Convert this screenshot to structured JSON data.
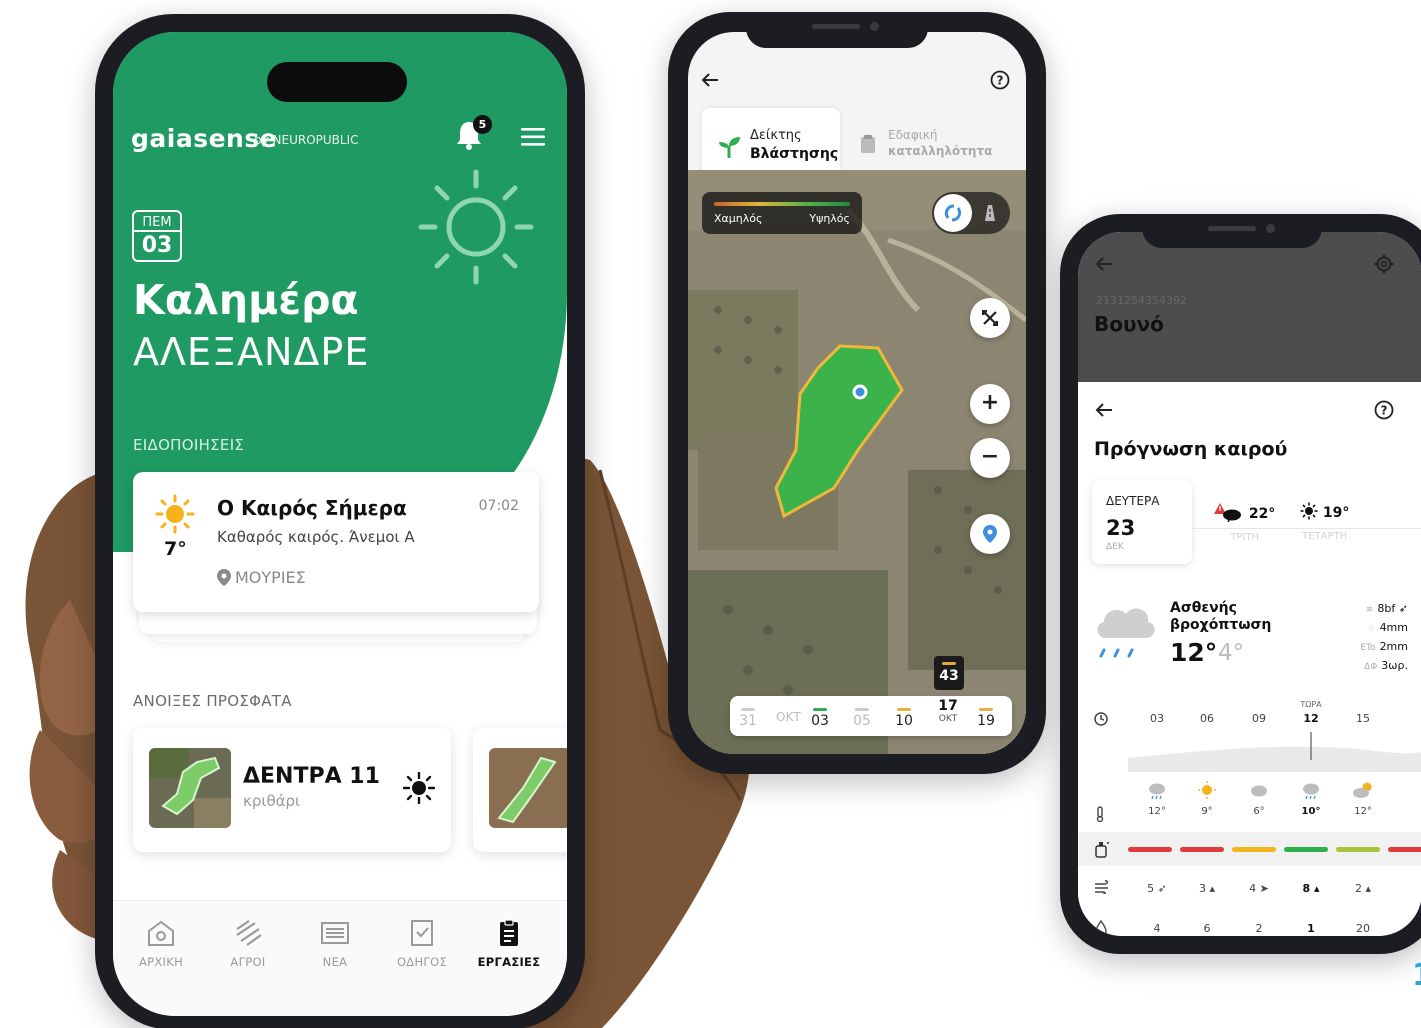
{
  "home": {
    "brand": "gaiasense",
    "brand_by": "by NEUROPUBLIC",
    "notification_count": "5",
    "date_day": "ΠΕΜ",
    "date_num": "03",
    "greeting": "Καλημέρα",
    "user_name": "ΑΛΕΞΑΝΔΡΕ",
    "notifications_label": "ΕΙΔΟΠΟΙΗΣΕΙΣ",
    "notification": {
      "title": "Ο Καιρός Σήμερα",
      "time": "07:02",
      "body": "Καθαρός καιρός. Άνεμοι Α",
      "temp": "7°",
      "location": "ΜΟΥΡΙΕΣ"
    },
    "recent_label": "ΑΝΟΙΞΕΣ ΠΡΟΣΦΑΤΑ",
    "recent": [
      {
        "title": "ΔΕΝΤΡΑ 11",
        "subtitle": "κριθάρι",
        "weather_icon": "sun-icon"
      }
    ],
    "nav": [
      {
        "label": "ΑΡΧΙΚΗ",
        "icon": "home-icon",
        "active": false
      },
      {
        "label": "ΑΓΡΟΙ",
        "icon": "fields-icon",
        "active": false
      },
      {
        "label": "ΝΕΑ",
        "icon": "news-icon",
        "active": false
      },
      {
        "label": "ΟΔΗΓΟΣ",
        "icon": "guide-icon",
        "active": false
      },
      {
        "label": "ΕΡΓΑΣΙΕΣ",
        "icon": "tasks-icon",
        "active": true
      }
    ],
    "accent": "#1f9a62"
  },
  "map": {
    "tab_active": {
      "line1": "Δείκτης",
      "line2": "Βλάστησης"
    },
    "tab_inactive": {
      "line1": "Εδαφική",
      "line2": "καταλληλότητα"
    },
    "legend_low": "Χαμηλός",
    "legend_high": "Υψηλός",
    "timeline": {
      "items": [
        "31",
        "ΟΚΤ",
        "03",
        "05",
        "10",
        "17",
        "19"
      ],
      "selected_day": "17",
      "selected_month": "ΟΚΤ",
      "popup_value": "43"
    }
  },
  "forecast": {
    "field_id": "2131254354392",
    "field_name": "Βουνό",
    "title": "Πρόγνωση καιρού",
    "today": {
      "name": "ΔΕΥΤΕΡΑ",
      "day": "23",
      "month": "ΔΕΚ"
    },
    "next_days": [
      {
        "name": "ΤΡΙΤΗ",
        "temp": "22°",
        "icon": "storm-warning-icon"
      },
      {
        "name": "ΤΕΤΑΡΤΗ",
        "temp": "19°",
        "icon": "sun-icon"
      }
    ],
    "current": {
      "description_line1": "Ασθενής",
      "description_line2": "βροχόπτωση",
      "max": "12°",
      "min": "4°",
      "wind": "8bf",
      "rain": "4mm",
      "eto_label": "ETo",
      "eto": "2mm",
      "dp_label": "ΔΦ",
      "dp": "3ωρ."
    },
    "now_label": "ΤΩΡΑ",
    "hours": [
      "03",
      "06",
      "09",
      "12",
      "15"
    ],
    "temps": [
      "12°",
      "9°",
      "6°",
      "10°",
      "12°"
    ],
    "winds": [
      "5",
      "3",
      "4",
      "8",
      "2"
    ],
    "rains": [
      "4",
      "6",
      "2",
      "1",
      "20"
    ],
    "spray_colors": [
      "#e03a3a",
      "#e03a3a",
      "#f2b51e",
      "#2fae4e",
      "#a8c23a",
      "#e03a3a"
    ]
  },
  "page_number": "1"
}
